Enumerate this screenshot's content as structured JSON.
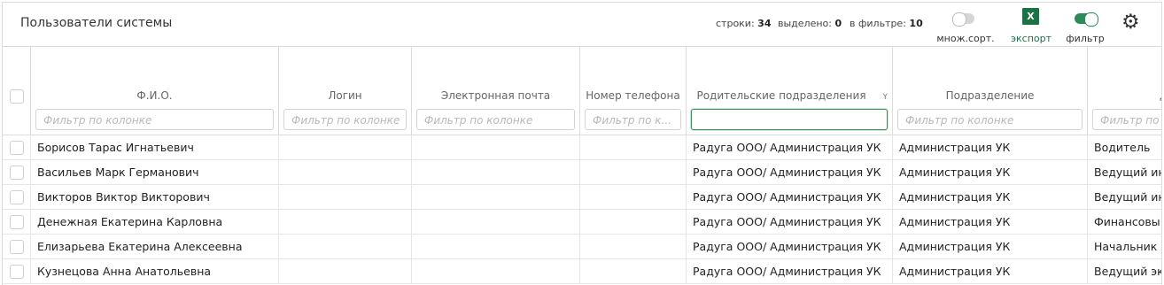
{
  "title": "Пользователи системы",
  "stats": {
    "rows_label": "строки:",
    "rows_value": "34",
    "selected_label": "выделено:",
    "selected_value": "0",
    "filtered_label": "в фильтре:",
    "filtered_value": "10"
  },
  "tools": {
    "multisort_label": "множ.сорт.",
    "export_icon_text": "X",
    "export_label": "экспорт",
    "filter_label": "фильтр",
    "multisort_on": false,
    "filter_on": true,
    "accent_color": "#1d7245"
  },
  "columns": [
    {
      "label": "Ф.И.О.",
      "placeholder": "Фильтр по колонке"
    },
    {
      "label": "Логин",
      "placeholder": "Фильтр по колонке"
    },
    {
      "label": "Электронная почта",
      "placeholder": "Фильтр по колонке"
    },
    {
      "label": "Номер телефона",
      "placeholder": "Фильтр по к..."
    },
    {
      "label": "Родительские подразделения",
      "placeholder": ""
    },
    {
      "label": "Подразделение",
      "placeholder": "Фильтр по колонке"
    },
    {
      "label": "Д",
      "placeholder": "Фильтр по"
    }
  ],
  "rows": [
    [
      "Борисов Тарас Игнатьевич",
      "",
      "",
      "",
      "Радуга ООО/ Администрация УК",
      "Администрация УК",
      "Водитель"
    ],
    [
      "Васильев Марк Германович",
      "",
      "",
      "",
      "Радуга ООО/ Администрация УК",
      "Администрация УК",
      "Ведущий ин"
    ],
    [
      "Викторов Виктор Викторович",
      "",
      "",
      "",
      "Радуга ООО/ Администрация УК",
      "Администрация УК",
      "Ведущий ин"
    ],
    [
      "Денежная Екатерина Карловна",
      "",
      "",
      "",
      "Радуга ООО/ Администрация УК",
      "Администрация УК",
      "Финансовы"
    ],
    [
      "Елизарьева Екатерина Алексеевна",
      "",
      "",
      "",
      "Радуга ООО/ Администрация УК",
      "Администрация УК",
      "Начальник"
    ],
    [
      "Кузнецова Анна Анатольевна",
      "",
      "",
      "",
      "Радуга ООО/ Администрация УК",
      "Администрация УК",
      "Ведущий эк"
    ]
  ]
}
